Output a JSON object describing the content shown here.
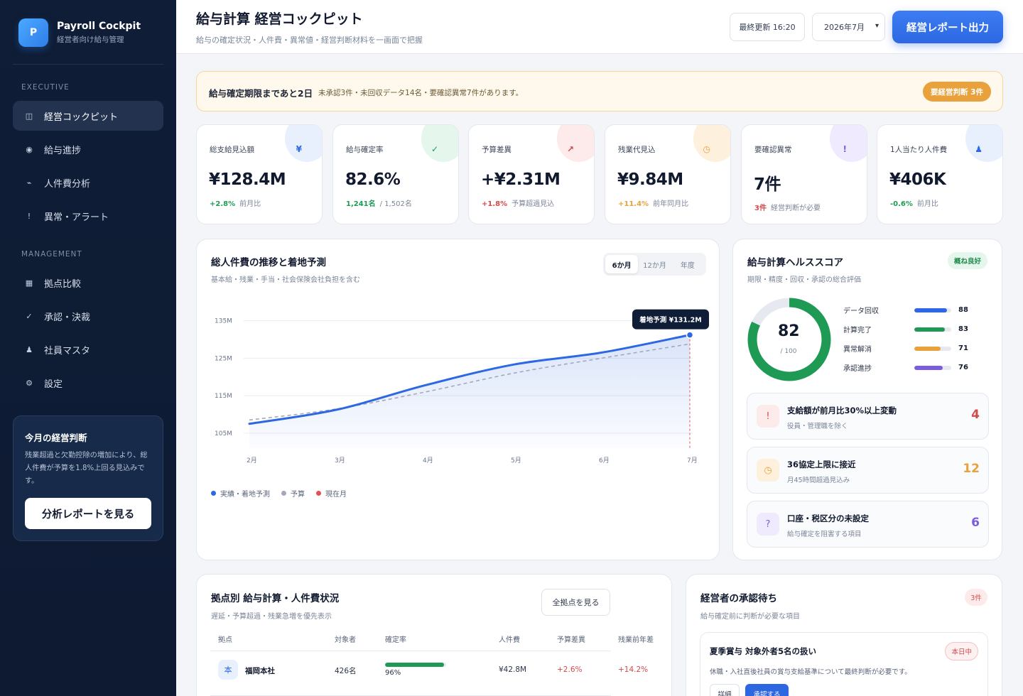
{
  "sidebar": {
    "brand_logo": "P",
    "brand_title": "Payroll Cockpit",
    "brand_sub": "経営者向け給与管理",
    "section_executive": "EXECUTIVE",
    "section_management": "MANAGEMENT",
    "items": [
      {
        "label": "経営コックピット",
        "icon": "◫",
        "active": true
      },
      {
        "label": "給与進捗",
        "icon": "◉"
      },
      {
        "label": "人件費分析",
        "icon": "⌁"
      },
      {
        "label": "異常・アラート",
        "icon": "!"
      },
      {
        "label": "拠点比較",
        "icon": "▦"
      },
      {
        "label": "承認・決裁",
        "icon": "✓"
      },
      {
        "label": "社員マスタ",
        "icon": "♟"
      },
      {
        "label": "設定",
        "icon": "⚙"
      }
    ],
    "decision_title": "今月の経営判断",
    "decision_text": "残業超過と欠勤控除の増加により、総人件費が予算を1.8%上回る見込みです。",
    "decision_button": "分析レポートを見る"
  },
  "header": {
    "title": "給与計算 経営コックピット",
    "subtitle": "給与の確定状況・人件費・異常値・経営判断材料を一画面で把握",
    "last_updated": "最終更新 16:20",
    "month": "2026年7月",
    "export_button": "経営レポート出力"
  },
  "banner": {
    "strong": "給与確定期限まであと2日",
    "text": "未承認3件・未回収データ14名・要確認異常7件があります。",
    "badge": "要経営判断 3件"
  },
  "kpis": [
    {
      "label": "総支給見込額",
      "value": "¥128.4M",
      "delta": "+2.8%",
      "note": "前月比",
      "icon": "¥",
      "accent": "#2d68e2",
      "blob": "#e8f0fd",
      "delta_color": "#1f9a55"
    },
    {
      "label": "給与確定率",
      "value": "82.6%",
      "delta": "1,241名",
      "note": "/ 1,502名",
      "icon": "✓",
      "accent": "#1f9a55",
      "blob": "#e5f6ec",
      "delta_color": "#1f9a55"
    },
    {
      "label": "予算差異",
      "value": "+¥2.31M",
      "delta": "+1.8%",
      "note": "予算超過見込",
      "icon": "↗",
      "accent": "#d24b4b",
      "blob": "#fdeaea",
      "delta_color": "#d24b4b"
    },
    {
      "label": "残業代見込",
      "value": "¥9.84M",
      "delta": "+11.4%",
      "note": "前年同月比",
      "icon": "◷",
      "accent": "#e9a13b",
      "blob": "#fdf1dd",
      "delta_color": "#e9a13b"
    },
    {
      "label": "要確認異常",
      "value": "7件",
      "delta": "3件",
      "note": "経営判断が必要",
      "icon": "!",
      "accent": "#7a5ce0",
      "blob": "#efeafd",
      "delta_color": "#d24b4b"
    },
    {
      "label": "1人当たり人件費",
      "value": "¥406K",
      "delta": "-0.6%",
      "note": "前月比",
      "icon": "♟",
      "accent": "#2d68e2",
      "blob": "#e8f0fd",
      "delta_color": "#1f9a55"
    }
  ],
  "trend": {
    "title": "総人件費の推移と着地予測",
    "subtitle": "基本給・残業・手当・社会保険会社負担を含む",
    "tabs": [
      "6か月",
      "12か月",
      "年度"
    ],
    "active_tab": 0,
    "tooltip": "着地予測 ¥131.2M",
    "legend": [
      {
        "label": "実績・着地予測",
        "color": "#2d68e2"
      },
      {
        "label": "予算",
        "color": "#a3a9b8"
      },
      {
        "label": "現在月",
        "color": "#e05252"
      }
    ]
  },
  "chart_data": {
    "type": "line",
    "title": "総人件費の推移と着地予測",
    "x": [
      "2月",
      "3月",
      "4月",
      "5月",
      "6月",
      "7月"
    ],
    "y_ticks": [
      "105M",
      "115M",
      "125M",
      "135M"
    ],
    "ylim": [
      101,
      137
    ],
    "series": [
      {
        "name": "実績・着地予測",
        "values": [
          107.5,
          111.3,
          117.8,
          123.3,
          126.5,
          131.2
        ],
        "color": "#2d68e2"
      },
      {
        "name": "予算",
        "values": [
          108.5,
          111.5,
          116.0,
          121.0,
          125.0,
          128.8
        ],
        "color": "#a3a9b8"
      }
    ],
    "current_month": "7月",
    "annotation": "着地予測 ¥131.2M"
  },
  "health": {
    "title": "給与計算ヘルススコア",
    "subtitle": "期限・精度・回収・承認の総合評価",
    "badge": "概ね良好",
    "score": "82",
    "score_fraction": 0.82,
    "score_of": "/ 100",
    "metrics": [
      {
        "label": "データ回収",
        "value": "88",
        "fraction": 0.88,
        "color": "#2d68e2"
      },
      {
        "label": "計算完了",
        "value": "83",
        "fraction": 0.83,
        "color": "#1f9a55"
      },
      {
        "label": "異常解消",
        "value": "71",
        "fraction": 0.71,
        "color": "#e9a13b"
      },
      {
        "label": "承認進捗",
        "value": "76",
        "fraction": 0.76,
        "color": "#7a5ce0"
      }
    ],
    "alerts": [
      {
        "title": "支給額が前月比30%以上変動",
        "sub": "役員・管理職を除く",
        "count": "4",
        "icon": "!",
        "color": "#d24b4b",
        "bg": "#fdeaea"
      },
      {
        "title": "36協定上限に接近",
        "sub": "月45時間超過見込み",
        "count": "12",
        "icon": "◷",
        "color": "#e9a13b",
        "bg": "#fdf1dd"
      },
      {
        "title": "口座・税区分の未設定",
        "sub": "給与確定を阻害する項目",
        "count": "6",
        "icon": "?",
        "color": "#7a5ce0",
        "bg": "#efeafd"
      }
    ]
  },
  "sites": {
    "title": "拠点別 給与計算・人件費状況",
    "subtitle": "遅延・予算超過・残業急増を優先表示",
    "button": "全拠点を見る",
    "columns": [
      "拠点",
      "対象者",
      "確定率",
      "人件費",
      "予算差異",
      "残業前年差"
    ],
    "rows": [
      {
        "badge": "本",
        "name": "福岡本社",
        "headcount": "426名",
        "rate": "96%",
        "rate_fraction": 0.96,
        "cost": "¥42.8M",
        "budget_diff": "+2.6%",
        "overtime_diff": "+14.2%"
      }
    ]
  },
  "approvals": {
    "title": "経営者の承認待ち",
    "subtitle": "給与確定前に判断が必要な項目",
    "count": "3件",
    "items": [
      {
        "title": "夏季賞与 対象外者5名の扱い",
        "tag": "本日中",
        "text": "休職・入社直後社員の賞与支給基準について最終判断が必要です。",
        "detail_button": "詳細",
        "approve_button": "承認する"
      }
    ]
  }
}
